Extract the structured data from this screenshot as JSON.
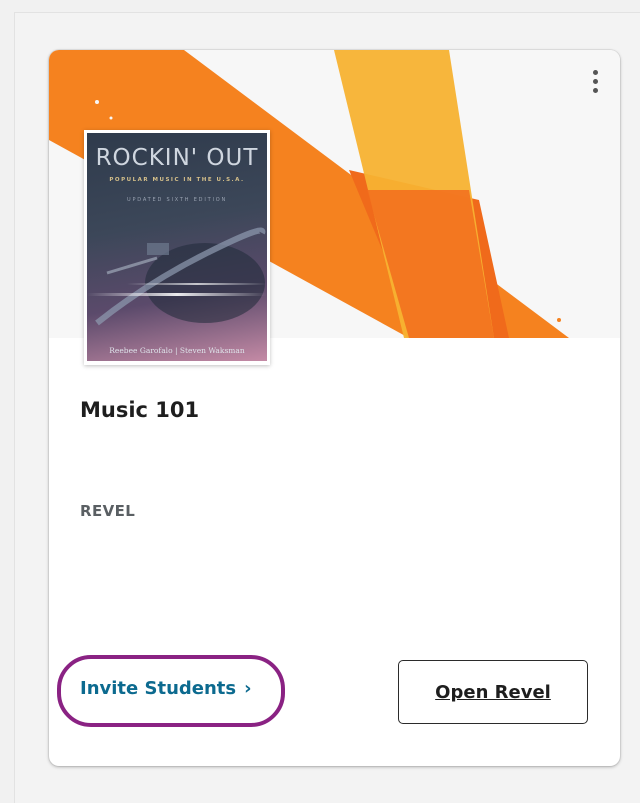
{
  "course": {
    "title": "Music 101",
    "brand": "REVEL"
  },
  "book": {
    "title": "ROCKIN' OUT",
    "subtitle": "POPULAR MUSIC IN THE U.S.A.",
    "edition": "UPDATED SIXTH EDITION",
    "authors": "Reebee Garofalo | Steven Waksman"
  },
  "actions": {
    "invite_label": "Invite Students",
    "invite_chevron": "›",
    "open_label": "Open Revel"
  },
  "icons": {
    "menu": "kebab-icon",
    "chevron": "chevron-right-icon"
  },
  "colors": {
    "accent_link": "#0c6a8f",
    "highlight_ring": "#8a2283",
    "banner_orange": "#f5821f",
    "banner_yellow": "#f7b231"
  }
}
